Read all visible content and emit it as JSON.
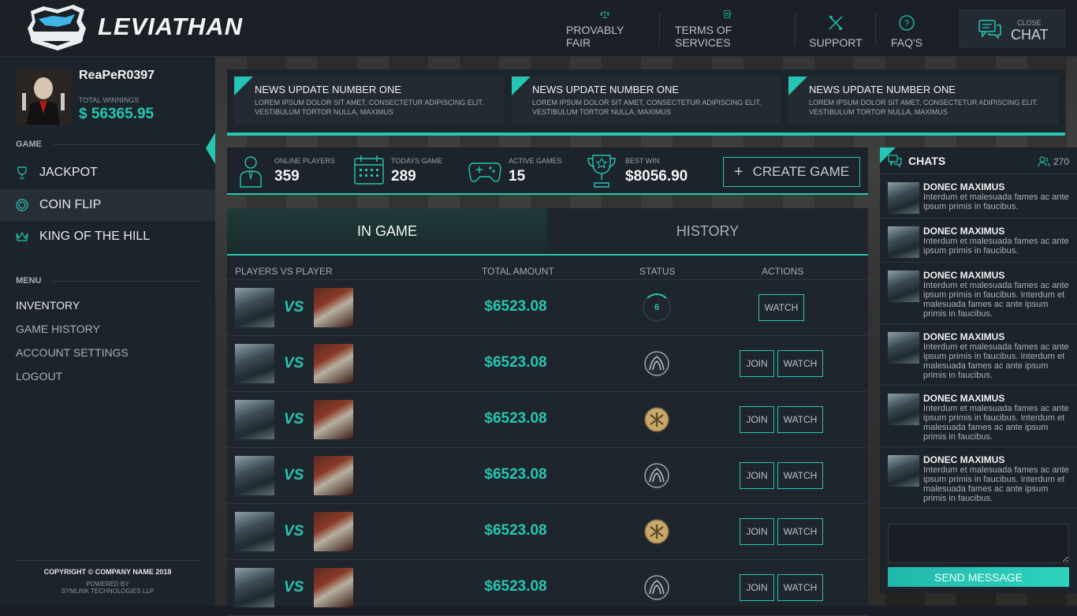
{
  "brand": {
    "name": "LEVIATHAN",
    "badge_text": "LEVIATHAN"
  },
  "topnav": [
    {
      "label": "PROVABLY FAIR",
      "icon": "scales-icon"
    },
    {
      "label": "TERMS OF SERVICES",
      "icon": "document-pen-icon"
    },
    {
      "label": "SUPPORT",
      "icon": "tools-icon"
    },
    {
      "label": "FAQ'S",
      "icon": "question-circle-icon"
    }
  ],
  "close_chat": {
    "small": "CLOSE",
    "big": "CHAT",
    "icon": "chat-bubbles-icon"
  },
  "user": {
    "name": "ReaPeR0397",
    "winnings_label": "TOTAL WINNINGS",
    "winnings_value": "$ 56365.95"
  },
  "sidebar": {
    "game_label": "GAME",
    "games": [
      {
        "label": "JACKPOT",
        "icon": "trophy-icon"
      },
      {
        "label": "COIN FLIP",
        "icon": "coin-icon",
        "active": true
      },
      {
        "label": "KING OF THE HILL",
        "icon": "crown-icon"
      }
    ],
    "menu_label": "MENU",
    "menu": [
      "INVENTORY",
      "GAME HISTORY",
      "ACCOUNT SETTINGS",
      "LOGOUT"
    ],
    "copyright": "COPYRIGHT © COMPANY NAME 2018",
    "powered_1": "POWERED BY",
    "powered_2": "SYMLINK TECHNOLOGIES LLP"
  },
  "news": [
    {
      "title": "NEWS UPDATE NUMBER ONE",
      "body": "LOREM IPSUM DOLOR SIT AMET, CONSECTETUR ADIPISCING ELIT. VESTIBULUM TORTOR NULLA, MAXIMUS"
    },
    {
      "title": "NEWS UPDATE NUMBER ONE",
      "body": "LOREM IPSUM DOLOR SIT AMET, CONSECTETUR ADIPISCING ELIT. VESTIBULUM TORTOR NULLA, MAXIMUS"
    },
    {
      "title": "NEWS UPDATE NUMBER ONE",
      "body": "LOREM IPSUM DOLOR SIT AMET, CONSECTETUR ADIPISCING ELIT. VESTIBULUM TORTOR NULLA, MAXIMUS"
    }
  ],
  "stats": [
    {
      "label": "ONLINE PLAYERS",
      "value": "359",
      "icon": "person-icon"
    },
    {
      "label": "TODAYS GAME",
      "value": "289",
      "icon": "calendar-icon"
    },
    {
      "label": "ACTIVE GAMES",
      "value": "15",
      "icon": "gamepad-icon"
    },
    {
      "label": "BEST WIN",
      "value": "$8056.90",
      "icon": "trophy-star-icon"
    }
  ],
  "create_game": {
    "plus": "+",
    "label": "CREATE GAME"
  },
  "tabs": {
    "in_game": "IN GAME",
    "history": "HISTORY"
  },
  "table": {
    "headers": [
      "PLAYERS VS PLAYER",
      "TOTAL AMOUNT",
      "STATUS",
      "ACTIONS"
    ],
    "vs_text": "VS",
    "join_label": "JOIN",
    "watch_label": "WATCH",
    "rows": [
      {
        "amount": "$6523.08",
        "status": "timer",
        "timer": "6",
        "actions": [
          "WATCH"
        ]
      },
      {
        "amount": "$6523.08",
        "status": "ct-emblem-icon",
        "actions": [
          "JOIN",
          "WATCH"
        ]
      },
      {
        "amount": "$6523.08",
        "status": "t-emblem-icon",
        "actions": [
          "JOIN",
          "WATCH"
        ]
      },
      {
        "amount": "$6523.08",
        "status": "ct-emblem-icon",
        "actions": [
          "JOIN",
          "WATCH"
        ]
      },
      {
        "amount": "$6523.08",
        "status": "t-emblem-icon",
        "actions": [
          "JOIN",
          "WATCH"
        ]
      },
      {
        "amount": "$6523.08",
        "status": "ct-emblem-icon",
        "actions": [
          "JOIN",
          "WATCH"
        ]
      }
    ]
  },
  "chat": {
    "title": "CHATS",
    "count": "270",
    "messages": [
      {
        "name": "DONEC MAXIMUS",
        "text": "Interdum et malesuada fames ac ante ipsum primis in faucibus."
      },
      {
        "name": "DONEC MAXIMUS",
        "text": "Interdum et malesuada fames ac ante ipsum primis in faucibus."
      },
      {
        "name": "DONEC MAXIMUS",
        "text": "Interdum et malesuada fames ac ante ipsum primis in faucibus. Interdum et malesuada fames ac ante ipsum primis in faucibus."
      },
      {
        "name": "DONEC MAXIMUS",
        "text": "Interdum et malesuada fames ac ante ipsum primis in faucibus. Interdum et malesuada fames ac ante ipsum primis in faucibus."
      },
      {
        "name": "DONEC MAXIMUS",
        "text": "Interdum et malesuada fames ac ante ipsum primis in faucibus. Interdum et malesuada fames ac ante ipsum primis in faucibus."
      },
      {
        "name": "DONEC MAXIMUS",
        "text": "Interdum et malesuada fames ac ante ipsum primis in faucibus. Interdum et malesuada fames ac ante ipsum primis in faucibus."
      }
    ],
    "send_label": "SEND MESSAGE",
    "input_value": ""
  },
  "colors": {
    "accent": "#25c6b3",
    "background": "#1a1f25",
    "panel": "#1d232a"
  }
}
